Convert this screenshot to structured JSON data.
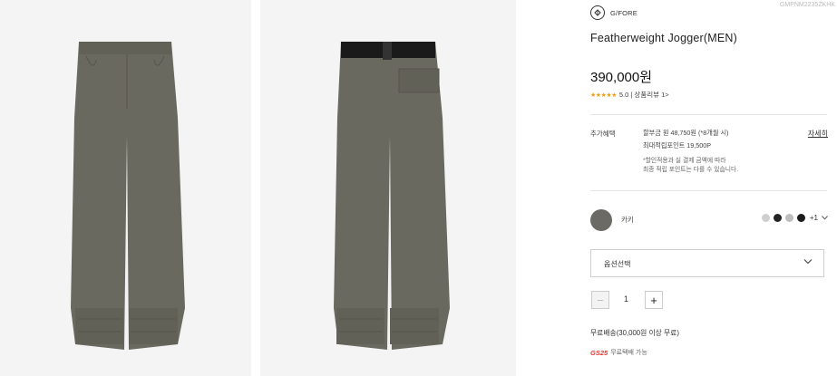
{
  "product_images": [
    {
      "alt": "front"
    },
    {
      "alt": "back"
    }
  ],
  "brand": {
    "name": "G/FORE",
    "logo": "gfore-logo"
  },
  "sku": "GMPNM2235ZKHK",
  "title": "Featherweight Jogger(MEN)",
  "price": "390,000원",
  "rating": {
    "stars": "★★★★★",
    "text": "5.0 | 상품리뷰 1>"
  },
  "benefits": {
    "label": "추가혜택",
    "line1": "할부금 원 48,750원 (*8개월 시)",
    "line2": "최대적립포인트 19,500P",
    "note1": "*할인적용과 실 결제 금액에 따라",
    "note2": "최종 적립 포인트는 다를 수 있습니다.",
    "detail_link": "자세히"
  },
  "color": {
    "selected": "카키",
    "selected_hex": "#6b6a64",
    "swatches": [
      "#cfcfcf",
      "#222222",
      "#bdbdbd",
      "#1c1c1c"
    ],
    "more": "+1",
    "more_icon": "chevron-down-icon"
  },
  "option_select": {
    "label": "옵션선택"
  },
  "quantity": {
    "minus": "−",
    "value": "1",
    "plus": "+"
  },
  "shipping": "무료배송(30,000원 이상 무료)",
  "gs25": {
    "logo_prefix": "GS",
    "logo_num": "25",
    "text": "무료택배 가능"
  }
}
